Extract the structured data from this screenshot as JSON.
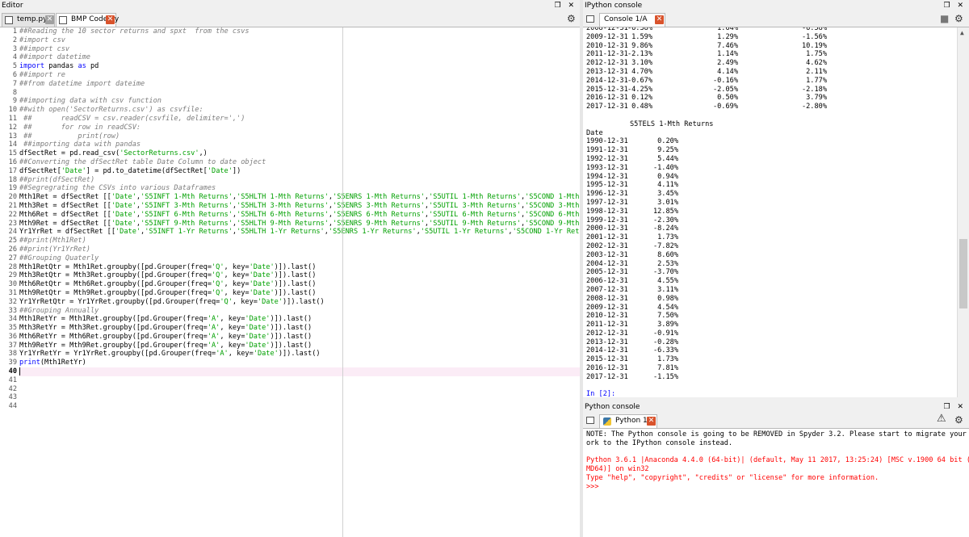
{
  "editor": {
    "title": "Editor",
    "tabs": [
      {
        "label": "temp.py"
      },
      {
        "label": "BMP Code.py"
      }
    ],
    "lines": [
      {
        "n": "1",
        "html": "<span class='cm'>##Reading the 10 sector returns and spxt  from the csvs</span>"
      },
      {
        "n": "2",
        "html": "<span class='cm'>#import csv</span>"
      },
      {
        "n": "3",
        "html": "<span class='cm'>##import csv</span>"
      },
      {
        "n": "4",
        "html": "<span class='cm'>##import datetime</span>"
      },
      {
        "n": "5",
        "html": "<span class='kw'>import</span> pandas <span class='kw'>as</span> pd"
      },
      {
        "n": "6",
        "html": "<span class='cm'>##import re</span>"
      },
      {
        "n": "7",
        "html": "<span class='cm'>##from datetime import dateime</span>"
      },
      {
        "n": "8",
        "html": ""
      },
      {
        "n": "9",
        "html": "<span class='cm'>##importing data with csv function</span>"
      },
      {
        "n": "10",
        "html": "<span class='cm'>##with open('SectorReturns.csv') as csvfile:</span>"
      },
      {
        "n": "11",
        "html": "<span class='cm'> ##       readCSV = csv.reader(csvfile, delimiter=',')</span>"
      },
      {
        "n": "12",
        "html": "<span class='cm'> ##       for row in readCSV:</span>"
      },
      {
        "n": "13",
        "html": "<span class='cm'> ##           print(row)</span>"
      },
      {
        "n": "14",
        "html": "<span class='cm'> ##importing data with pandas</span>"
      },
      {
        "n": "15",
        "html": "dfSectRet = pd.read_csv(<span class='st'>'SectorReturns.csv'</span>,)"
      },
      {
        "n": "16",
        "html": "<span class='cm'>##Converting the dfSectRet table Date Column to date object</span>"
      },
      {
        "n": "17",
        "html": "dfSectRet[<span class='st'>'Date'</span>] = pd.to_datetime(dfSectRet[<span class='st'>'Date'</span>])"
      },
      {
        "n": "18",
        "html": "<span class='cm'>##print(dfSectRet)</span>"
      },
      {
        "n": "19",
        "html": "<span class='cm'>##Segregrating the CSVs into various Dataframes</span>"
      },
      {
        "n": "20",
        "html": "Mth1Ret = dfSectRet [[<span class='st'>'Date'</span>,<span class='st'>'S5INFT 1-Mth Returns'</span>,<span class='st'>'S5HLTH 1-Mth Returns'</span>,<span class='st'>'S5ENRS 1-Mth Returns'</span>,<span class='st'>'S5UTIL 1-Mth Returns'</span>,<span class='st'>'S5COND 1-Mth R</span>"
      },
      {
        "n": "21",
        "html": "Mth3Ret = dfSectRet [[<span class='st'>'Date'</span>,<span class='st'>'S5INFT 3-Mth Returns'</span>,<span class='st'>'S5HLTH 3-Mth Returns'</span>,<span class='st'>'S5ENRS 3-Mth Returns'</span>,<span class='st'>'S5UTIL 3-Mth Returns'</span>,<span class='st'>'S5COND 3-Mth R</span>"
      },
      {
        "n": "22",
        "html": "Mth6Ret = dfSectRet [[<span class='st'>'Date'</span>,<span class='st'>'S5INFT 6-Mth Returns'</span>,<span class='st'>'S5HLTH 6-Mth Returns'</span>,<span class='st'>'S5ENRS 6-Mth Returns'</span>,<span class='st'>'S5UTIL 6-Mth Returns'</span>,<span class='st'>'S5COND 6-Mth R</span>"
      },
      {
        "n": "23",
        "html": "Mth9Ret = dfSectRet [[<span class='st'>'Date'</span>,<span class='st'>'S5INFT 9-Mth Returns'</span>,<span class='st'>'S5HLTH 9-Mth Returns'</span>,<span class='st'>'S5ENRS 9-Mth Returns'</span>,<span class='st'>'S5UTIL 9-Mth Returns'</span>,<span class='st'>'S5COND 9-Mth R</span>"
      },
      {
        "n": "24",
        "html": "Yr1YrRet = dfSectRet [[<span class='st'>'Date'</span>,<span class='st'>'S5INFT 1-Yr Returns'</span>,<span class='st'>'S5HLTH 1-Yr Returns'</span>,<span class='st'>'S5ENRS 1-Yr Returns'</span>,<span class='st'>'S5UTIL 1-Yr Returns'</span>,<span class='st'>'S5COND 1-Yr Retur</span>"
      },
      {
        "n": "25",
        "html": "<span class='cm'>##print(Mth1Ret)</span>"
      },
      {
        "n": "26",
        "html": "<span class='cm'>##print(Yr1YrRet)</span>"
      },
      {
        "n": "27",
        "html": "<span class='cm'>##Grouping Quaterly</span>"
      },
      {
        "n": "28",
        "html": "Mth1RetQtr = Mth1Ret.groupby([pd.Grouper(freq=<span class='st'>'Q'</span>, key=<span class='st'>'Date'</span>)]).last()"
      },
      {
        "n": "29",
        "html": "Mth3RetQtr = Mth3Ret.groupby([pd.Grouper(freq=<span class='st'>'Q'</span>, key=<span class='st'>'Date'</span>)]).last()"
      },
      {
        "n": "30",
        "html": "Mth6RetQtr = Mth6Ret.groupby([pd.Grouper(freq=<span class='st'>'Q'</span>, key=<span class='st'>'Date'</span>)]).last()"
      },
      {
        "n": "31",
        "html": "Mth9RetQtr = Mth9Ret.groupby([pd.Grouper(freq=<span class='st'>'Q'</span>, key=<span class='st'>'Date'</span>)]).last()"
      },
      {
        "n": "32",
        "html": "Yr1YrRetQtr = Yr1YrRet.groupby([pd.Grouper(freq=<span class='st'>'Q'</span>, key=<span class='st'>'Date'</span>)]).last()"
      },
      {
        "n": "33",
        "html": "<span class='cm'>##Grouping Annually</span>"
      },
      {
        "n": "34",
        "html": "Mth1RetYr = Mth1Ret.groupby([pd.Grouper(freq=<span class='st'>'A'</span>, key=<span class='st'>'Date'</span>)]).last()"
      },
      {
        "n": "35",
        "html": "Mth3RetYr = Mth3Ret.groupby([pd.Grouper(freq=<span class='st'>'A'</span>, key=<span class='st'>'Date'</span>)]).last()"
      },
      {
        "n": "36",
        "html": "Mth6RetYr = Mth6Ret.groupby([pd.Grouper(freq=<span class='st'>'A'</span>, key=<span class='st'>'Date'</span>)]).last()"
      },
      {
        "n": "37",
        "html": "Mth9RetYr = Mth9Ret.groupby([pd.Grouper(freq=<span class='st'>'A'</span>, key=<span class='st'>'Date'</span>)]).last()"
      },
      {
        "n": "38",
        "html": "Yr1YrRetYr = Yr1YrRet.groupby([pd.Grouper(freq=<span class='st'>'A'</span>, key=<span class='st'>'Date'</span>)]).last()"
      },
      {
        "n": "39",
        "html": "<span class='kw'>print</span>(Mth1RetYr)"
      },
      {
        "n": "40",
        "html": "",
        "current": true
      },
      {
        "n": "41",
        "html": ""
      },
      {
        "n": "42",
        "html": ""
      },
      {
        "n": "43",
        "html": ""
      },
      {
        "n": "44",
        "html": ""
      }
    ]
  },
  "ipython": {
    "title": "IPython console",
    "tab_label": "Console 1/A",
    "top_rows": [
      {
        "date": "2008-12-31",
        "a": "-6.38%",
        "b": "1.64%",
        "c": "-6.58%"
      },
      {
        "date": "2009-12-31",
        "a": "1.59%",
        "b": "1.29%",
        "c": "-1.56%"
      },
      {
        "date": "2010-12-31",
        "a": "9.86%",
        "b": "7.46%",
        "c": "10.19%"
      },
      {
        "date": "2011-12-31",
        "a": "-2.13%",
        "b": "1.14%",
        "c": "1.75%"
      },
      {
        "date": "2012-12-31",
        "a": "3.10%",
        "b": "2.49%",
        "c": "4.62%"
      },
      {
        "date": "2013-12-31",
        "a": "4.70%",
        "b": "4.14%",
        "c": "2.11%"
      },
      {
        "date": "2014-12-31",
        "a": "-0.67%",
        "b": "-0.16%",
        "c": "1.77%"
      },
      {
        "date": "2015-12-31",
        "a": "-4.25%",
        "b": "-2.05%",
        "c": "-2.18%"
      },
      {
        "date": "2016-12-31",
        "a": "0.12%",
        "b": "0.50%",
        "c": "3.79%"
      },
      {
        "date": "2017-12-31",
        "a": "0.48%",
        "b": "-0.69%",
        "c": "-2.80%"
      }
    ],
    "section_header": "S5TELS 1-Mth Returns",
    "index_label": "Date",
    "rows": [
      {
        "date": "1990-12-31",
        "v": "0.20%"
      },
      {
        "date": "1991-12-31",
        "v": "9.25%"
      },
      {
        "date": "1992-12-31",
        "v": "5.44%"
      },
      {
        "date": "1993-12-31",
        "v": "-1.40%"
      },
      {
        "date": "1994-12-31",
        "v": "0.94%"
      },
      {
        "date": "1995-12-31",
        "v": "4.11%"
      },
      {
        "date": "1996-12-31",
        "v": "3.45%"
      },
      {
        "date": "1997-12-31",
        "v": "3.01%"
      },
      {
        "date": "1998-12-31",
        "v": "12.85%"
      },
      {
        "date": "1999-12-31",
        "v": "-2.30%"
      },
      {
        "date": "2000-12-31",
        "v": "-8.24%"
      },
      {
        "date": "2001-12-31",
        "v": "1.73%"
      },
      {
        "date": "2002-12-31",
        "v": "-7.82%"
      },
      {
        "date": "2003-12-31",
        "v": "8.60%"
      },
      {
        "date": "2004-12-31",
        "v": "2.53%"
      },
      {
        "date": "2005-12-31",
        "v": "-3.70%"
      },
      {
        "date": "2006-12-31",
        "v": "4.55%"
      },
      {
        "date": "2007-12-31",
        "v": "3.11%"
      },
      {
        "date": "2008-12-31",
        "v": "0.98%"
      },
      {
        "date": "2009-12-31",
        "v": "4.54%"
      },
      {
        "date": "2010-12-31",
        "v": "7.50%"
      },
      {
        "date": "2011-12-31",
        "v": "3.89%"
      },
      {
        "date": "2012-12-31",
        "v": "-0.91%"
      },
      {
        "date": "2013-12-31",
        "v": "-0.28%"
      },
      {
        "date": "2014-12-31",
        "v": "-6.33%"
      },
      {
        "date": "2015-12-31",
        "v": "1.73%"
      },
      {
        "date": "2016-12-31",
        "v": "7.81%"
      },
      {
        "date": "2017-12-31",
        "v": "-1.15%"
      }
    ],
    "prompt": "In [2]:"
  },
  "python_console": {
    "title": "Python console",
    "tab_label": "Python 1",
    "note_line1": "NOTE: The Python console is going to be REMOVED in Spyder 3.2. Please start to migrate your w",
    "note_line2": "ork to the IPython console instead.",
    "err_line1": "Python 3.6.1 |Anaconda 4.4.0 (64-bit)| (default, May 11 2017, 13:25:24) [MSC v.1900 64 bit (A",
    "err_line2": "MD64)] on win32",
    "err_line3": "Type \"help\", \"copyright\", \"credits\" or \"license\" for more information.",
    "prompt": ">>>"
  },
  "window_controls": "❒ ✕",
  "tab_close": "✕",
  "warning_glyph": "⚠",
  "gear_glyph": "⚙",
  "stop_glyph": "■"
}
